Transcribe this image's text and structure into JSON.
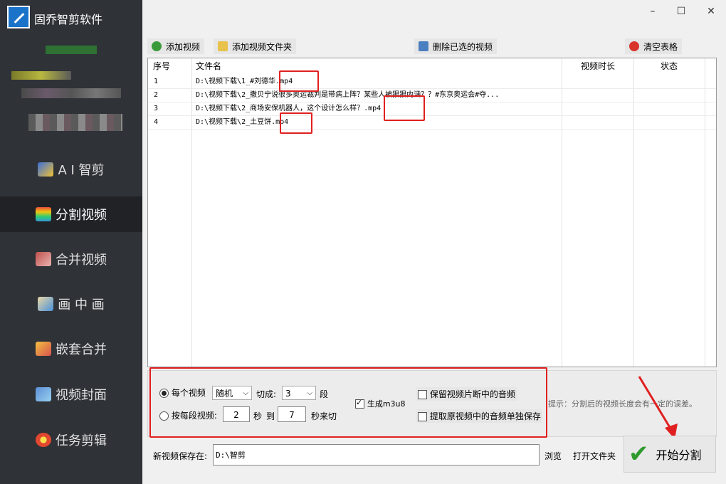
{
  "app": {
    "title": "固乔智剪软件"
  },
  "window": {
    "minimize": "–",
    "maximize": "☐",
    "close": "✕"
  },
  "sidebar": {
    "items": [
      {
        "label": "A I 智剪",
        "icon": "ai-edit-icon",
        "active": false
      },
      {
        "label": "分割视频",
        "icon": "split-video-icon",
        "active": true
      },
      {
        "label": "合并视频",
        "icon": "merge-video-icon",
        "active": false
      },
      {
        "label": "画 中 画",
        "icon": "picture-in-picture-icon",
        "active": false
      },
      {
        "label": "嵌套合并",
        "icon": "nested-merge-icon",
        "active": false
      },
      {
        "label": "视频封面",
        "icon": "video-cover-icon",
        "active": false
      },
      {
        "label": "任务剪辑",
        "icon": "task-edit-icon",
        "active": false
      }
    ]
  },
  "toolbar": {
    "add_video": "添加视频",
    "add_folder": "添加视频文件夹",
    "delete_selected": "删除已选的视频",
    "clear_table": "清空表格"
  },
  "table": {
    "headers": {
      "index": "序号",
      "filename": "文件名",
      "duration": "视频时长",
      "status": "状态"
    },
    "rows": [
      {
        "index": "1",
        "filename": "D:\\视频下载\\1_#刘德华.mp4",
        "duration": "",
        "status": ""
      },
      {
        "index": "2",
        "filename": "D:\\视频下载\\2_撒贝宁说很多奥运裁判是带病上阵？某些人被狠狠内涵？？#东京奥运会#夺...",
        "duration": "",
        "status": ""
      },
      {
        "index": "3",
        "filename": "D:\\视频下载\\2_商场安保机器人，这个设计怎么样？.mp4",
        "duration": "",
        "status": ""
      },
      {
        "index": "4",
        "filename": "D:\\视频下载\\2_土豆饼.mp4",
        "duration": "",
        "status": ""
      }
    ]
  },
  "options": {
    "each_video_label": "每个视频",
    "mode_select": "随机",
    "cut_into_label": "切成:",
    "segments_value": "3",
    "segments_unit": "段",
    "per_segment_label": "按每段视频:",
    "from_value": "2",
    "sec_label": "秒",
    "to_label": "到",
    "to_value": "7",
    "cut_label": "秒来切",
    "gen_m3u8_label": "生成m3u8",
    "keep_audio_label": "保留视频片断中的音频",
    "extract_audio_label": "提取原视频中的音频单独保存",
    "hint": "提示：分割后的视频长度会有一定的误差。"
  },
  "save": {
    "label": "新视频保存在:",
    "path": "D:\\智剪",
    "browse": "浏览",
    "open_folder": "打开文件夹"
  },
  "start": {
    "label": "开始分割"
  },
  "colors": {
    "sidebar_bg": "#2f3237",
    "highlight_red": "#e02020",
    "accent_green": "#2e9a2e"
  }
}
